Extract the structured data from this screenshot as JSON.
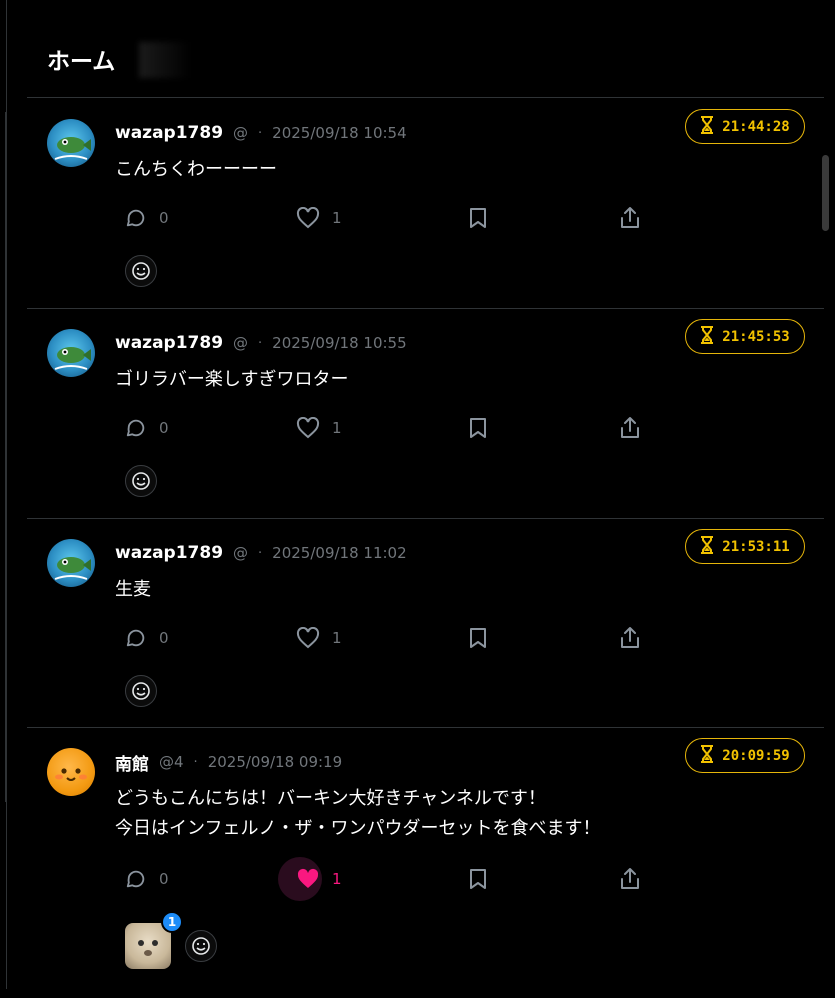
{
  "header": {
    "title": "ホーム"
  },
  "colors": {
    "accent_timer": "#f2c200",
    "like_active": "#f91880",
    "badge": "#1d8cf8"
  },
  "posts": [
    {
      "username": "wazap1789",
      "handle": "@",
      "date": "2025/09/18 10:54",
      "text": [
        "こんちくわーーーー"
      ],
      "timer": "21:44:28",
      "replies": "0",
      "likes": "1",
      "liked": false,
      "avatar": "fish-avatar"
    },
    {
      "username": "wazap1789",
      "handle": "@",
      "date": "2025/09/18 10:55",
      "text": [
        "ゴリラバー楽しすぎワロター"
      ],
      "timer": "21:45:53",
      "replies": "0",
      "likes": "1",
      "liked": false,
      "avatar": "fish-avatar"
    },
    {
      "username": "wazap1789",
      "handle": "@",
      "date": "2025/09/18 11:02",
      "text": [
        "生麦"
      ],
      "timer": "21:53:11",
      "replies": "0",
      "likes": "1",
      "liked": false,
      "avatar": "fish-avatar"
    },
    {
      "username": "南館",
      "handle": "@4",
      "date": "2025/09/18 09:19",
      "text": [
        "どうもこんにちは！バーキン大好きチャンネルです！",
        "今日はインフェルノ・ザ・ワンパウダーセットを食べます！"
      ],
      "timer": "20:09:59",
      "replies": "0",
      "likes": "1",
      "liked": true,
      "avatar": "orange-avatar",
      "reaction_count": "1"
    }
  ]
}
